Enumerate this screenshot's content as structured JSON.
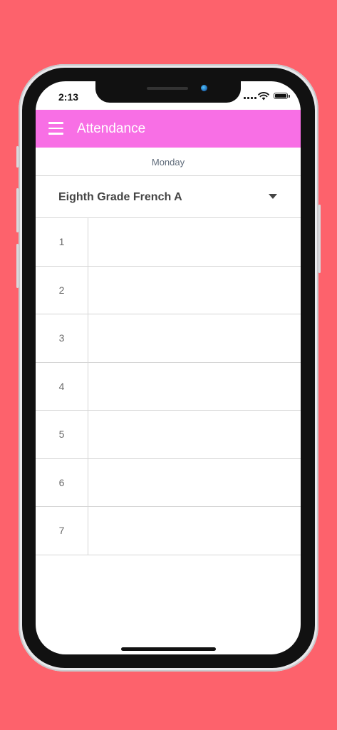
{
  "status_bar": {
    "time": "2:13"
  },
  "app_bar": {
    "title": "Attendance",
    "background_color": "#f86fe5",
    "menu_icon": "hamburger-menu-icon"
  },
  "schedule": {
    "day": "Monday",
    "selected_class": "Eighth Grade French A",
    "periods": [
      {
        "number": "1",
        "content": ""
      },
      {
        "number": "2",
        "content": ""
      },
      {
        "number": "3",
        "content": ""
      },
      {
        "number": "4",
        "content": ""
      },
      {
        "number": "5",
        "content": ""
      },
      {
        "number": "6",
        "content": ""
      },
      {
        "number": "7",
        "content": ""
      }
    ]
  },
  "theme": {
    "page_background": "#fd626c"
  }
}
